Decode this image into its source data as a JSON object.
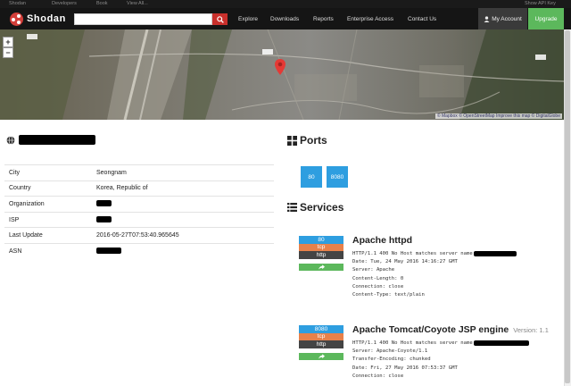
{
  "topbar": {
    "links": [
      "Shodan",
      "Developers",
      "Book",
      "View All..."
    ],
    "api_key": "Show API Key"
  },
  "navbar": {
    "brand": "Shodan",
    "search": {
      "value": "",
      "placeholder": ""
    },
    "links": [
      "Explore",
      "Downloads",
      "Reports",
      "Enterprise Access",
      "Contact Us"
    ],
    "account": "My Account",
    "upgrade": "Upgrade"
  },
  "map": {
    "zoom_in": "+",
    "zoom_out": "−",
    "attribution": "© Mapbox © OpenStreetMap Improve this map © DigitalGlobe"
  },
  "host": {
    "details": [
      {
        "label": "City",
        "value": "Seongnam",
        "redacted": false
      },
      {
        "label": "Country",
        "value": "Korea, Republic of",
        "redacted": false
      },
      {
        "label": "Organization",
        "value": "",
        "redacted": true
      },
      {
        "label": "ISP",
        "value": "",
        "redacted": true
      },
      {
        "label": "Last Update",
        "value": "2016-05-27T07:53:40.965645",
        "redacted": false
      },
      {
        "label": "ASN",
        "value": "",
        "redacted": true
      }
    ]
  },
  "ports": {
    "heading": "Ports",
    "list": [
      "80",
      "8080"
    ]
  },
  "services": {
    "heading": "Services",
    "items": [
      {
        "port": "80",
        "transport": "tcp",
        "protocol": "http",
        "title": "Apache httpd",
        "version": "",
        "banner": [
          "HTTP/1.1 400 No Host matches server name",
          "Date: Tue, 24 May 2016 14:16:27 GMT",
          "Server: Apache",
          "Content-Length: 0",
          "Connection: close",
          "Content-Type: text/plain"
        ]
      },
      {
        "port": "8080",
        "transport": "tcp",
        "protocol": "http",
        "title": "Apache Tomcat/Coyote JSP engine",
        "version": "Version: 1.1",
        "banner": [
          "HTTP/1.1 400 No Host matches server name",
          "Server: Apache-Coyote/1.1",
          "Transfer-Encoding: chunked",
          "Date: Fri, 27 May 2016 07:53:37 GMT",
          "Connection: close"
        ]
      }
    ]
  },
  "colors": {
    "accent_blue": "#2e9ee0",
    "tcp_orange": "#e8814a",
    "upgrade_green": "#5cb85c",
    "search_red": "#c9302c"
  }
}
